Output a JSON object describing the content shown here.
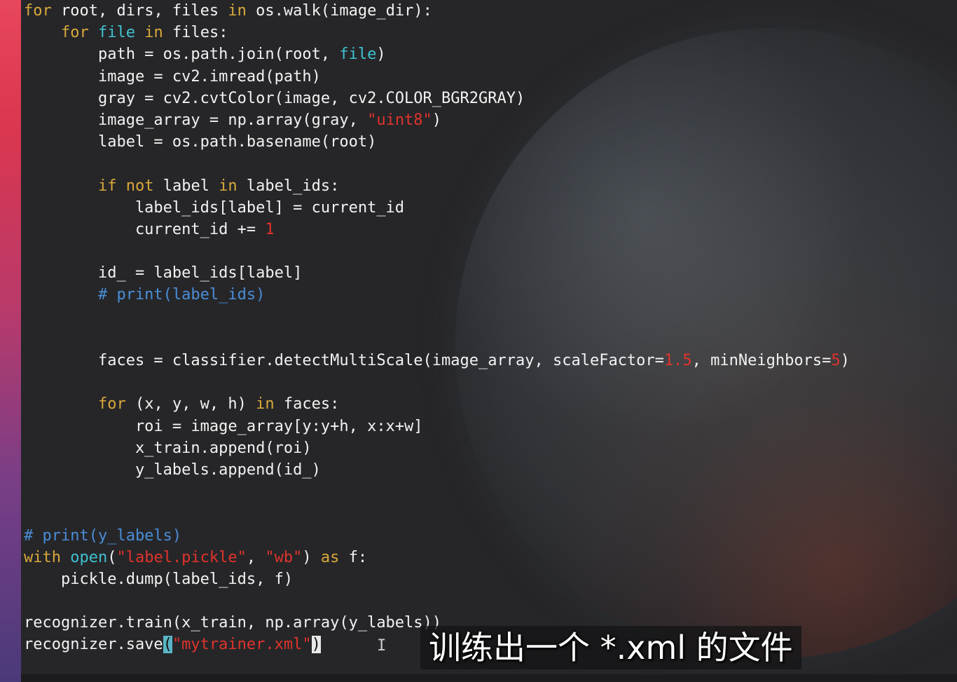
{
  "editor": {
    "lines": [
      [
        {
          "t": "for",
          "c": "kw"
        },
        {
          "t": " root, dirs, files "
        },
        {
          "t": "in",
          "c": "kw"
        },
        {
          "t": " os.walk(image_dir):"
        }
      ],
      [
        {
          "t": "    "
        },
        {
          "t": "for",
          "c": "kw"
        },
        {
          "t": " "
        },
        {
          "t": "file",
          "c": "bi"
        },
        {
          "t": " "
        },
        {
          "t": "in",
          "c": "kw"
        },
        {
          "t": " files:"
        }
      ],
      [
        {
          "t": "        path = os.path.join(root, "
        },
        {
          "t": "file",
          "c": "bi"
        },
        {
          "t": ")"
        }
      ],
      [
        {
          "t": "        image = cv2.imread(path)"
        }
      ],
      [
        {
          "t": "        gray = cv2.cvtColor(image, cv2.COLOR_BGR2GRAY)"
        }
      ],
      [
        {
          "t": "        image_array = np.array(gray, "
        },
        {
          "t": "\"uint8\"",
          "c": "str"
        },
        {
          "t": ")"
        }
      ],
      [
        {
          "t": "        label = os.path.basename(root)"
        }
      ],
      [
        {
          "t": ""
        }
      ],
      [
        {
          "t": "        "
        },
        {
          "t": "if",
          "c": "kw"
        },
        {
          "t": " "
        },
        {
          "t": "not",
          "c": "kw"
        },
        {
          "t": " label "
        },
        {
          "t": "in",
          "c": "kw"
        },
        {
          "t": " label_ids:"
        }
      ],
      [
        {
          "t": "            label_ids[label] = current_id"
        }
      ],
      [
        {
          "t": "            current_id += "
        },
        {
          "t": "1",
          "c": "num"
        }
      ],
      [
        {
          "t": ""
        }
      ],
      [
        {
          "t": "        id_ = label_ids[label]"
        }
      ],
      [
        {
          "t": "        # print(label_ids)",
          "c": "cmt"
        }
      ],
      [
        {
          "t": ""
        }
      ],
      [
        {
          "t": ""
        }
      ],
      [
        {
          "t": "        faces = classifier.detectMultiScale(image_array, scaleFactor="
        },
        {
          "t": "1.5",
          "c": "num"
        },
        {
          "t": ", minNeighbors="
        },
        {
          "t": "5",
          "c": "num"
        },
        {
          "t": ")"
        }
      ],
      [
        {
          "t": ""
        }
      ],
      [
        {
          "t": "        "
        },
        {
          "t": "for",
          "c": "kw"
        },
        {
          "t": " (x, y, w, h) "
        },
        {
          "t": "in",
          "c": "kw"
        },
        {
          "t": " faces:"
        }
      ],
      [
        {
          "t": "            roi = image_array[y:y+h, x:x+w]"
        }
      ],
      [
        {
          "t": "            x_train.append(roi)"
        }
      ],
      [
        {
          "t": "            y_labels.append(id_)"
        }
      ],
      [
        {
          "t": ""
        }
      ],
      [
        {
          "t": ""
        }
      ],
      [
        {
          "t": "# print(y_labels)",
          "c": "cmt"
        }
      ],
      [
        {
          "t": "with",
          "c": "kw"
        },
        {
          "t": " "
        },
        {
          "t": "open",
          "c": "bi"
        },
        {
          "t": "("
        },
        {
          "t": "\"label.pickle\"",
          "c": "str"
        },
        {
          "t": ", "
        },
        {
          "t": "\"wb\"",
          "c": "str"
        },
        {
          "t": ") "
        },
        {
          "t": "as",
          "c": "kw"
        },
        {
          "t": " f:"
        }
      ],
      [
        {
          "t": "    pickle.dump(label_ids, f)"
        }
      ],
      [
        {
          "t": ""
        }
      ],
      [
        {
          "t": "recognizer.train(x_train, np.array(y_labels))"
        }
      ],
      [
        {
          "t": "recognizer.save"
        },
        {
          "t": "(",
          "c": "match-paren"
        },
        {
          "t": "\"mytrainer.xml\"",
          "c": "str"
        },
        {
          "t": ")",
          "c": "cursor-paren"
        }
      ]
    ]
  },
  "cursor": {
    "symbol": "I"
  },
  "subtitle": {
    "text": "训练出一个 *.xml 的文件"
  }
}
